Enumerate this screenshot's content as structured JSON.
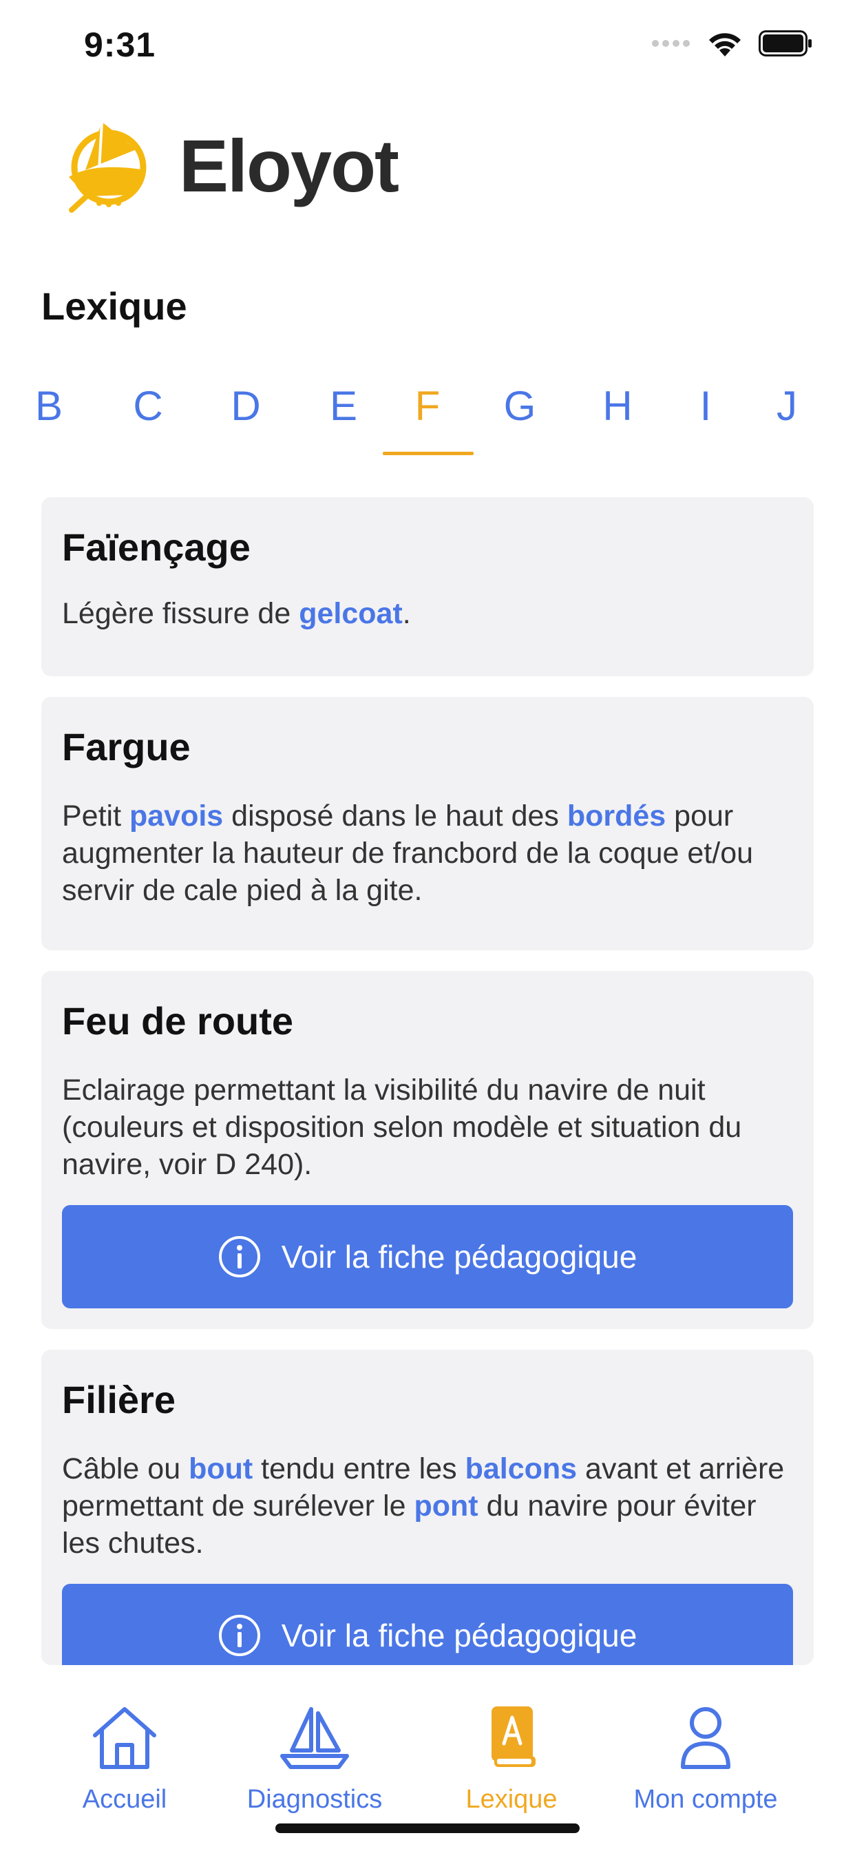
{
  "status_bar": {
    "time": "9:31"
  },
  "header": {
    "app_name": "Eloyot"
  },
  "section": {
    "title": "Lexique"
  },
  "letters": [
    "B",
    "C",
    "D",
    "E",
    "F",
    "G",
    "H",
    "I",
    "J"
  ],
  "active_letter": "F",
  "entries": [
    {
      "term": "Faïençage",
      "definition_parts": [
        [
          "Légère fissure de ",
          false
        ],
        [
          "gelcoat",
          true
        ],
        [
          ".",
          false
        ]
      ]
    },
    {
      "term": "Fargue",
      "definition_parts": [
        [
          "Petit ",
          false
        ],
        [
          "pavois",
          true
        ],
        [
          " disposé dans le haut des ",
          false
        ],
        [
          "bordés",
          true
        ],
        [
          " pour augmenter la hauteur de francbord de la coque et/ou servir de cale pied à la gite.",
          false
        ]
      ]
    },
    {
      "term": "Feu de route",
      "definition_parts": [
        [
          "Eclairage permettant la visibilité du navire de nuit (couleurs et disposition selon modèle et situation du navire, voir D 240).",
          false
        ]
      ],
      "button": "Voir la fiche pédagogique"
    },
    {
      "term": "Filière",
      "definition_parts": [
        [
          "Câble ou ",
          false
        ],
        [
          "bout",
          true
        ],
        [
          " tendu entre les ",
          false
        ],
        [
          "balcons",
          true
        ],
        [
          " avant et arrière permettant de surélever le ",
          false
        ],
        [
          "pont",
          true
        ],
        [
          " du navire pour éviter les chutes.",
          false
        ]
      ],
      "button": "Voir la fiche pédagogique"
    }
  ],
  "nav": [
    {
      "label": "Accueil",
      "icon": "home-icon"
    },
    {
      "label": "Diagnostics",
      "icon": "sailboat-icon"
    },
    {
      "label": "Lexique",
      "icon": "book-icon",
      "active": true
    },
    {
      "label": "Mon compte",
      "icon": "user-icon"
    }
  ],
  "colors": {
    "accent": "#4a76e6",
    "active": "#f0a821",
    "card_bg": "#f2f2f4"
  }
}
